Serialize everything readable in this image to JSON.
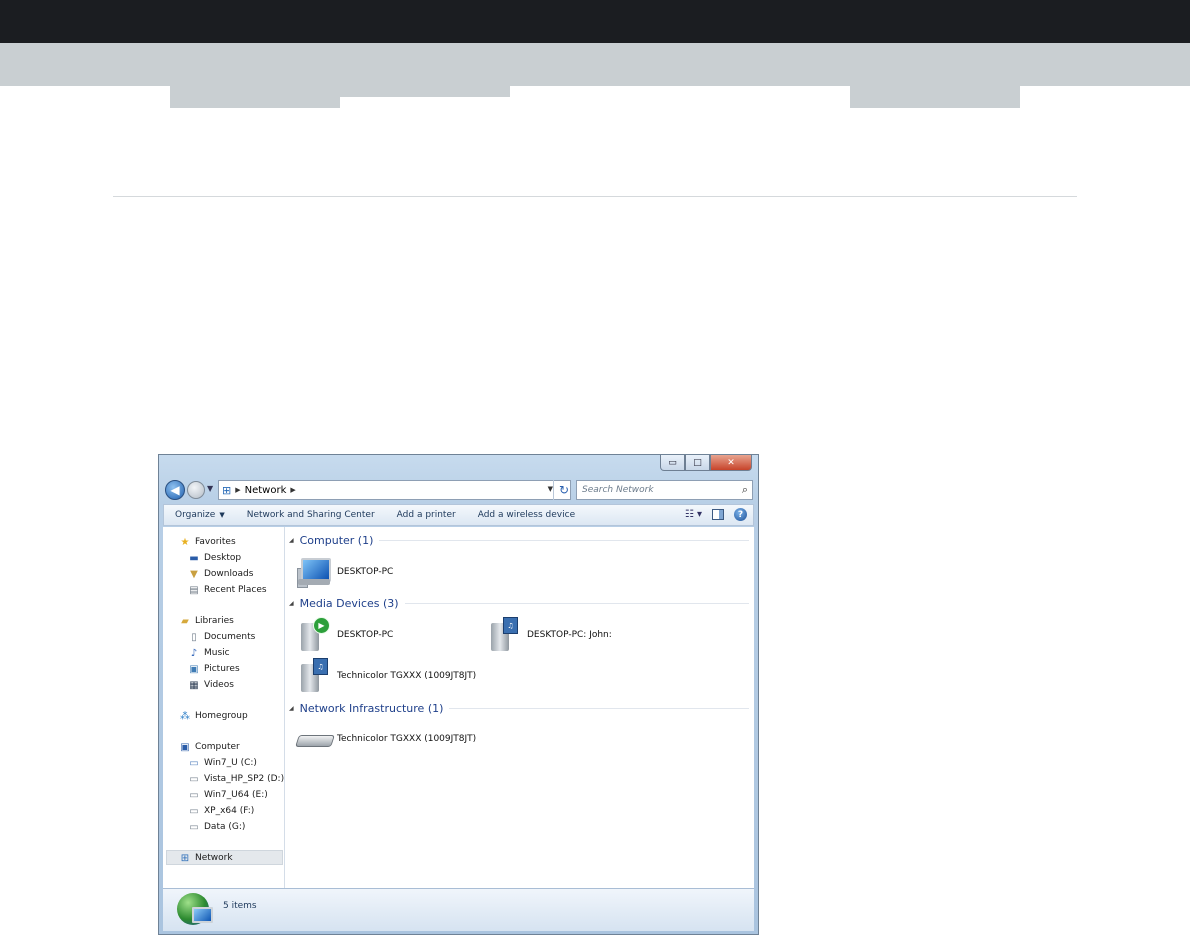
{
  "window": {
    "controls": {
      "minimize": "▭",
      "maximize": "□",
      "close": "✕"
    },
    "address": {
      "crumb": "Network"
    },
    "search": {
      "placeholder": "Search Network"
    },
    "toolbar": {
      "organize": "Organize",
      "network_sharing": "Network and Sharing Center",
      "add_printer": "Add a printer",
      "add_wireless": "Add a wireless device"
    },
    "nav": {
      "favorites": "Favorites",
      "desktop": "Desktop",
      "downloads": "Downloads",
      "recent": "Recent Places",
      "libraries": "Libraries",
      "documents": "Documents",
      "music": "Music",
      "pictures": "Pictures",
      "videos": "Videos",
      "homegroup": "Homegroup",
      "computer": "Computer",
      "drives": [
        "Win7_U (C:)",
        "Vista_HP_SP2 (D:)",
        "Win7_U64 (E:)",
        "XP_x64 (F:)",
        "Data (G:)"
      ],
      "network": "Network"
    },
    "groups": {
      "computer": {
        "label": "Computer (1)",
        "items": [
          "DESKTOP-PC"
        ]
      },
      "media": {
        "label": "Media Devices (3)",
        "items": [
          "DESKTOP-PC",
          "DESKTOP-PC: John:",
          "Technicolor TGXXX (1009JT8JT)"
        ]
      },
      "infrastructure": {
        "label": "Network Infrastructure (1)",
        "items": [
          "Technicolor TGXXX (1009JT8JT)"
        ]
      }
    },
    "status": {
      "count": "5 items"
    }
  },
  "icons": [
    "back-icon",
    "forward-icon",
    "network-icon",
    "refresh-icon",
    "search-icon",
    "star-icon",
    "folder-icon",
    "music-icon",
    "homegroup-icon",
    "computer-icon",
    "drive-icon",
    "play-icon",
    "film-icon",
    "router-icon",
    "globe-icon",
    "help-icon",
    "views-icon",
    "preview-pane-icon"
  ]
}
